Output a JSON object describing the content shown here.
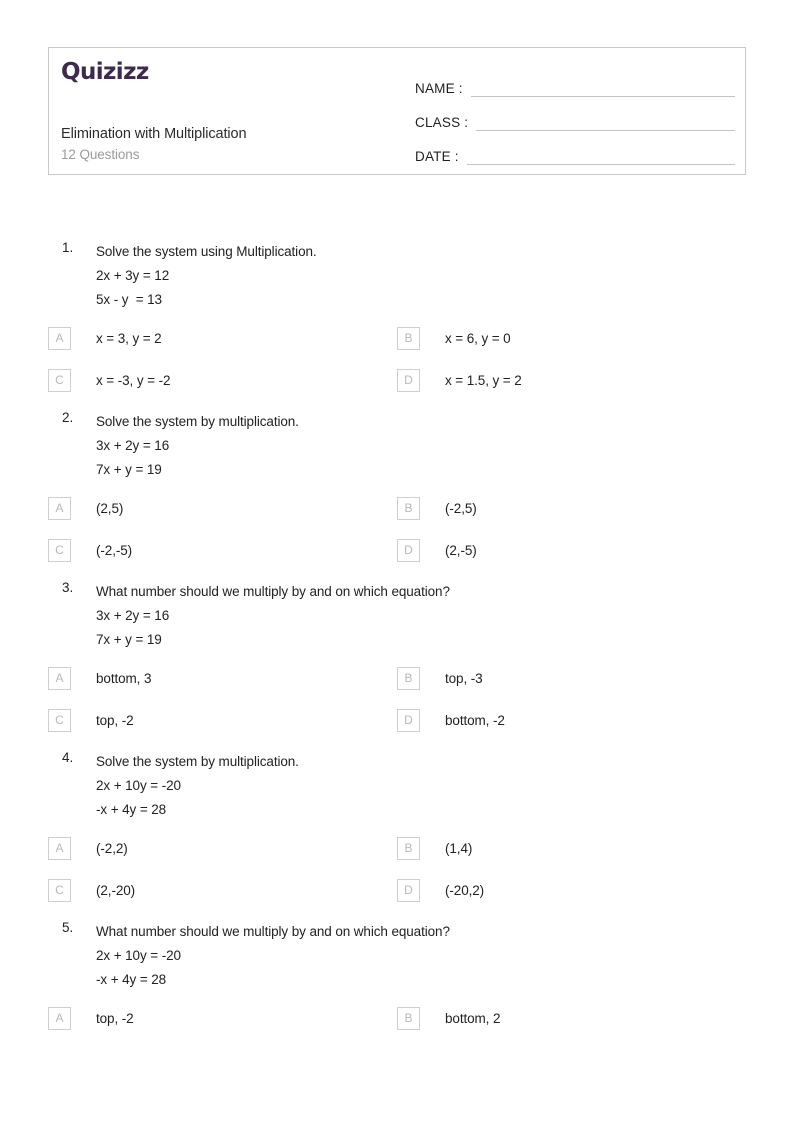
{
  "header": {
    "logo_text": "Quizizz",
    "quiz_title": "Elimination with Multiplication",
    "question_count_label": "12 Questions",
    "fields": [
      {
        "label": "NAME :",
        "value": ""
      },
      {
        "label": "CLASS :",
        "value": ""
      },
      {
        "label": "DATE  :",
        "value": ""
      }
    ]
  },
  "questions": [
    {
      "number": "1.",
      "text": "Solve the system using Multiplication.",
      "equations": [
        "2x + 3y = 12",
        "5x - y  = 13"
      ],
      "options": [
        {
          "letter": "A",
          "text": "x = 3, y = 2"
        },
        {
          "letter": "B",
          "text": "x = 6, y = 0"
        },
        {
          "letter": "C",
          "text": "x = -3, y = -2"
        },
        {
          "letter": "D",
          "text": "x = 1.5, y = 2"
        }
      ]
    },
    {
      "number": "2.",
      "text": "Solve the system by multiplication.",
      "equations": [
        "3x + 2y = 16",
        "7x + y = 19"
      ],
      "options": [
        {
          "letter": "A",
          "text": "(2,5)"
        },
        {
          "letter": "B",
          "text": "(-2,5)"
        },
        {
          "letter": "C",
          "text": "(-2,-5)"
        },
        {
          "letter": "D",
          "text": "(2,-5)"
        }
      ]
    },
    {
      "number": "3.",
      "text": "What number should we multiply by and on which equation?",
      "equations": [
        "3x + 2y = 16",
        "7x + y = 19"
      ],
      "options": [
        {
          "letter": "A",
          "text": "bottom, 3"
        },
        {
          "letter": "B",
          "text": "top, -3"
        },
        {
          "letter": "C",
          "text": "top, -2"
        },
        {
          "letter": "D",
          "text": "bottom, -2"
        }
      ]
    },
    {
      "number": "4.",
      "text": "Solve the system by multiplication.",
      "equations": [
        "2x + 10y = -20",
        "-x + 4y = 28"
      ],
      "options": [
        {
          "letter": "A",
          "text": "(-2,2)"
        },
        {
          "letter": "B",
          "text": "(1,4)"
        },
        {
          "letter": "C",
          "text": "(2,-20)"
        },
        {
          "letter": "D",
          "text": "(-20,2)"
        }
      ]
    },
    {
      "number": "5.",
      "text": "What number should we multiply by and on which equation?",
      "equations": [
        "2x + 10y = -20",
        "-x + 4y = 28"
      ],
      "options": [
        {
          "letter": "A",
          "text": "top, -2"
        },
        {
          "letter": "B",
          "text": "bottom, 2"
        }
      ]
    }
  ],
  "colors": {
    "logo": "#3d2a4d",
    "title": "#2b2b2b",
    "subtitle": "#9b9b9b",
    "body_text": "#222222",
    "card_border": "#c9c9c9",
    "option_box_border": "#cfcfcf",
    "option_letter": "#b8b8b8",
    "field_line": "#c4c4c4",
    "page_background": "#ffffff"
  }
}
